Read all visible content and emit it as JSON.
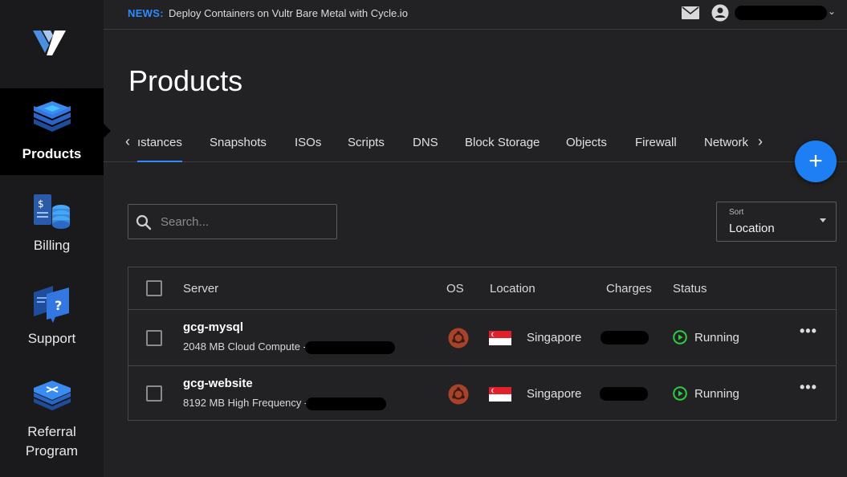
{
  "sidebar": {
    "items": [
      {
        "label": "Products",
        "icon": "products-icon",
        "active": true
      },
      {
        "label": "Billing",
        "icon": "billing-icon"
      },
      {
        "label": "Support",
        "icon": "support-icon"
      },
      {
        "label": "Referral Program",
        "icon": "referral-icon"
      }
    ]
  },
  "topbar": {
    "news_tag": "NEWS:",
    "news_text": "Deploy Containers on Vultr Bare Metal with Cycle.io"
  },
  "page": {
    "title": "Products"
  },
  "tabs": {
    "items": [
      "ıstances",
      "Snapshots",
      "ISOs",
      "Scripts",
      "DNS",
      "Block Storage",
      "Objects",
      "Firewall",
      "Network"
    ],
    "prev_arrow": "‹",
    "next_arrow": "›"
  },
  "fab": {
    "label": "+"
  },
  "search": {
    "placeholder": "Search..."
  },
  "sort": {
    "label": "Sort",
    "value": "Location"
  },
  "table": {
    "headers": [
      "Server",
      "OS",
      "Location",
      "Charges",
      "Status"
    ],
    "rows": [
      {
        "name": "gcg-mysql",
        "desc": "2048 MB Cloud Compute -",
        "location": "Singapore",
        "status": "Running",
        "more": "•••"
      },
      {
        "name": "gcg-website",
        "desc": "8192 MB High Frequency -",
        "location": "Singapore",
        "status": "Running",
        "more": "•••"
      }
    ]
  },
  "colors": {
    "accent": "#2f8bff",
    "fab": "#1e7ff5",
    "status_running": "#2ecc40",
    "ubuntu": "#a8432a",
    "flag_red": "#e0202a"
  }
}
